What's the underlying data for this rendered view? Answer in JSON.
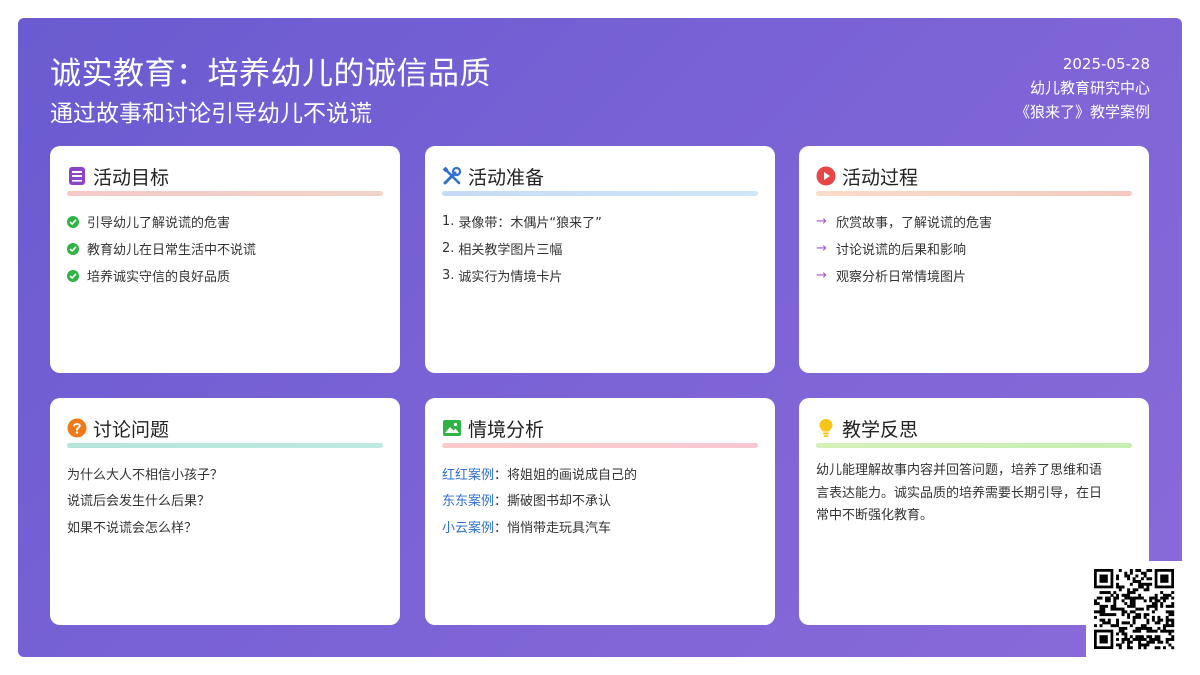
{
  "header": {
    "title": "诚实教育：培养幼儿的诚信品质",
    "subtitle": "通过故事和讨论引导幼儿不说谎",
    "date": "2025-05-28",
    "org": "幼儿教育研究中心",
    "case": "《狼来了》教学案例"
  },
  "cards": {
    "goals": {
      "title": "活动目标",
      "icon": "book-icon",
      "items": [
        "引导幼儿了解说谎的危害",
        "教育幼儿在日常生活中不说谎",
        "培养诚实守信的良好品质"
      ]
    },
    "prep": {
      "title": "活动准备",
      "icon": "tools-icon",
      "items": [
        "1.",
        "录像带：木偶片“狼来了”",
        "2.",
        "相关教学图片三幅",
        "3.",
        "诚实行为情境卡片"
      ]
    },
    "process": {
      "title": "活动过程",
      "icon": "play-icon",
      "items": [
        "欣赏故事，了解说谎的危害",
        "讨论说谎的后果和影响",
        "观察分析日常情境图片"
      ]
    },
    "questions": {
      "title": "讨论问题",
      "icon": "question-icon",
      "items": [
        "为什么大人不相信小孩子？",
        "说谎后会发生什么后果？",
        "如果不说谎会怎么样？"
      ]
    },
    "cases": {
      "title": "情境分析",
      "icon": "image-icon",
      "items": [
        {
          "name": "红红案例",
          "text": "：将姐姐的画说成自己的"
        },
        {
          "name": "东东案例",
          "text": "：撕破图书却不承认"
        },
        {
          "name": "小云案例",
          "text": "：悄悄带走玩具汽车"
        }
      ]
    },
    "reflection": {
      "title": "教学反思",
      "icon": "lightbulb-icon",
      "lines": [
        "幼儿能理解故事内容并回答问题，培养了思维和语",
        "言表达能力。诚实品质的培养需要长期引导，在日",
        "常中不断强化教育。"
      ]
    }
  },
  "colors": {
    "bg_start": "#6a5bd0",
    "bg_end": "#8a6ad8",
    "goals_line": "#f2c4c4",
    "prep_line": "#c6def5",
    "process_line": "#f6cfc4",
    "questions_line": "#b8e8da",
    "cases_line": "#f7c8cc",
    "reflection_line": "#c8f0b0"
  }
}
